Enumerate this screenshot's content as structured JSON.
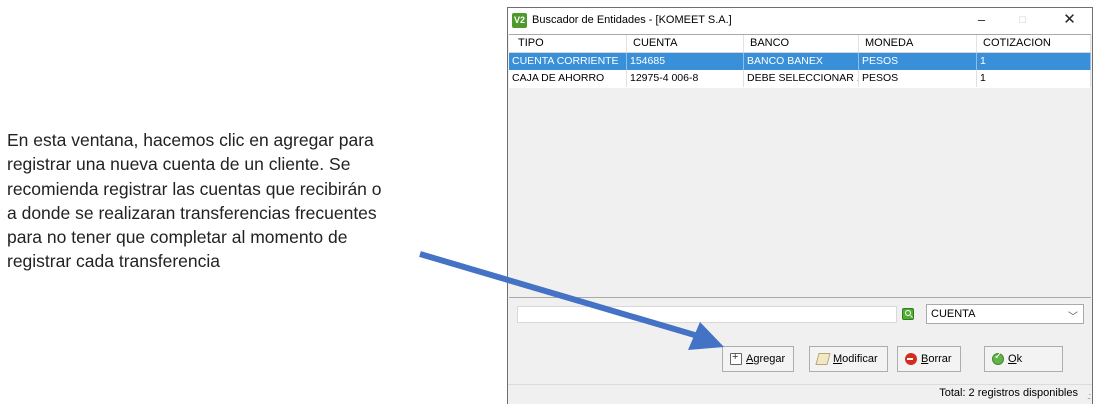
{
  "caption": {
    "text": "En esta ventana, hacemos clic en agregar para\nregistrar una nueva cuenta de un cliente. Se\nrecomienda registrar las cuentas que recibirán o\na donde se realizaran transferencias frecuentes\npara no tener que completar al momento de\nregistrar cada transferencia"
  },
  "window": {
    "app_icon": "V2",
    "title": "Buscador de Entidades - [KOMEET S.A.]",
    "controls": {
      "minimize": "–",
      "maximize": "□",
      "close": "✕"
    }
  },
  "table": {
    "columns": [
      "TIPO",
      "CUENTA",
      "BANCO",
      "MONEDA",
      "COTIZACION"
    ],
    "rows": [
      [
        "CUENTA CORRIENTE",
        "154685",
        "BANCO BANEX",
        "PESOS",
        "1"
      ],
      [
        "CAJA DE AHORRO",
        "12975-4 006-8",
        "DEBE SELECCIONAR ...",
        "PESOS",
        "1"
      ]
    ],
    "selected_row": 0
  },
  "search": {
    "value": "",
    "field_select": "CUENTA"
  },
  "buttons": {
    "add": "Agregar",
    "modify": "Modificar",
    "delete": "Borrar",
    "ok": "Ok"
  },
  "status": {
    "text": "Total: 2 registros disponibles"
  },
  "colors": {
    "selection": "#3a8fd9",
    "arrow": "#4472c4"
  }
}
